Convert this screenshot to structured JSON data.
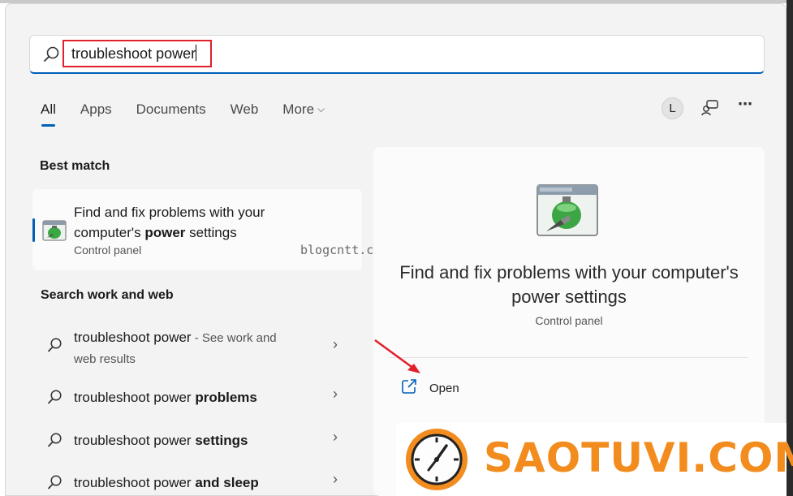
{
  "search": {
    "value": "troubleshoot power"
  },
  "tabs": [
    {
      "label": "All"
    },
    {
      "label": "Apps"
    },
    {
      "label": "Documents"
    },
    {
      "label": "Web"
    },
    {
      "label": "More"
    }
  ],
  "header": {
    "avatar_letter": "L"
  },
  "best_match": {
    "heading": "Best match",
    "title_pre": "Find and fix problems with your",
    "title_line2_pre": "computer's ",
    "title_bold": "power",
    "title_post": " settings",
    "subtitle": "Control panel"
  },
  "watermark": "blogcntt.com",
  "search_web": {
    "heading": "Search work and web",
    "items": [
      {
        "query": "troubleshoot power",
        "hint": " - See work and",
        "hint2": "web results",
        "bold": ""
      },
      {
        "query": "troubleshoot power ",
        "bold": "problems"
      },
      {
        "query": "troubleshoot power ",
        "bold": "settings"
      },
      {
        "query": "troubleshoot power ",
        "bold": "and sleep"
      }
    ]
  },
  "detail": {
    "title": "Find and fix problems with your computer's power settings",
    "subtitle": "Control panel",
    "open_label": "Open"
  },
  "brand": {
    "text": "SAOTUVI.COM",
    "color": "#f28c1e"
  },
  "colors": {
    "accent": "#005fb8",
    "highlight_box": "#e0202a"
  }
}
